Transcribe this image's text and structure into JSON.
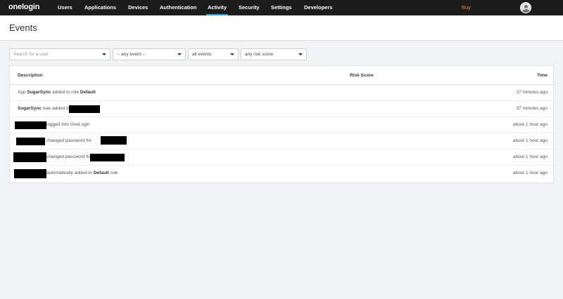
{
  "brand": {
    "logo": "onelogin"
  },
  "nav": {
    "items": [
      "Users",
      "Applications",
      "Devices",
      "Authentication",
      "Activity",
      "Security",
      "Settings",
      "Developers"
    ],
    "active": "Activity",
    "buy": "Buy"
  },
  "page": {
    "title": "Events"
  },
  "filters": {
    "user_placeholder": "Search for a user",
    "event": "-- any event --",
    "period": "all events",
    "risk": "any risk score"
  },
  "table": {
    "columns": {
      "description": "Description",
      "risk": "Risk Score",
      "time": "Time"
    },
    "rows": [
      {
        "p1": "App ",
        "b1": "SugarSync",
        "p2": " added to role ",
        "b2": "Default",
        "time": "37 minutes ago"
      },
      {
        "b1": "SugarSync",
        "p1": " was added by",
        "time": "37 minutes ago"
      },
      {
        "p1": "logged into OneLogin",
        "time": "about 1 hour ago"
      },
      {
        "p1": "changed password for",
        "time": "about 1 hour ago"
      },
      {
        "p1": "changed password for",
        "time": "about 1 hour ago"
      },
      {
        "p1": "automatically added to ",
        "b1": "Default",
        "p2": " role",
        "time": "about 1 hour ago"
      }
    ]
  },
  "colors": {
    "topbar": "#1c1c1c",
    "accent": "#1ea7d6",
    "buy": "#f58220",
    "background": "#f2f3f4"
  }
}
